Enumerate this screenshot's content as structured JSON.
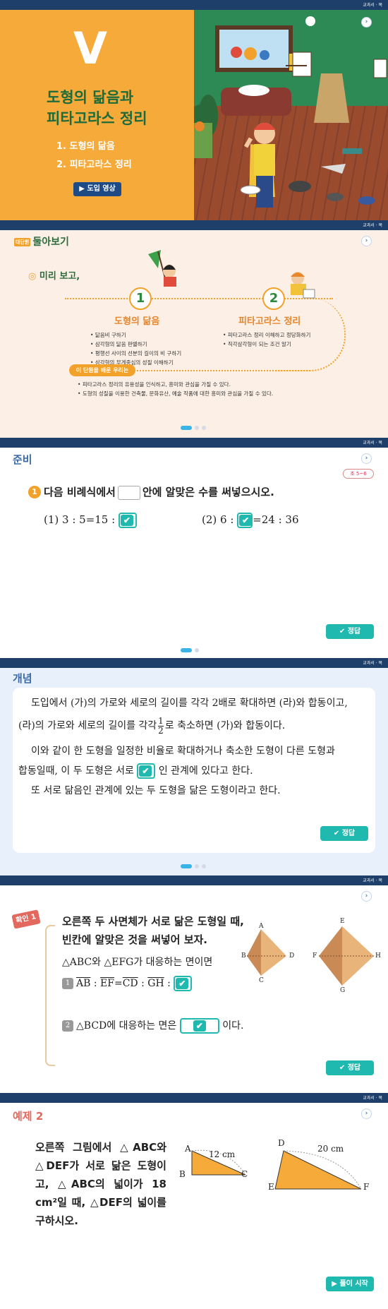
{
  "topbar": {
    "menu": "교과서 · 목"
  },
  "slide1": {
    "roman": "V",
    "title_line1": "도형의 닮음과",
    "title_line2": "피타고라스 정리",
    "items": [
      "1. 도형의 닮음",
      "2. 피타고라스 정리"
    ],
    "intro_button": "▶ 도입 영상"
  },
  "slide2": {
    "header_badge": "대단원",
    "header": "둘아보기",
    "preview": "미리 보고,",
    "sections": [
      {
        "num": "1",
        "title": "도형의 닮음",
        "items": [
          "닮음비 구하기",
          "삼각형의 닮음 판별하기",
          "평행선 사이의 선분의 길이의 비 구하기",
          "삼각형의 무게중심의 성질 이해하기"
        ]
      },
      {
        "num": "2",
        "title": "피타고라스 정리",
        "items": [
          "피타고라스 정리 이해하고 정당화하기",
          "직각삼각형이 되는 조건 알기"
        ]
      }
    ],
    "learned_tag": "이 단원을 배운 우리는",
    "learned_items": [
      "피타고라스 정리의 유용성을 인식하고, 흥미와 관심을 가질 수 있다.",
      "도형의 성질을 이용한 건축물, 문화유산, 예술 작품에 대한 흥미와 관심을 가질 수 있다."
    ]
  },
  "slide3": {
    "header": "준비",
    "page_ref": "초 5~6",
    "q_num": "1",
    "q_before": "다음 비례식에서",
    "q_after": "안에 알맞은 수를 써넣으시오.",
    "p1_label": "(1) 3 : 5=15 :",
    "p2_label": "(2) 6 :",
    "p2_after": "=24 : 36",
    "answer_button": "✔ 정답"
  },
  "slide4": {
    "header": "개념",
    "para1_a": "도입에서 (가)의 가로와 세로의 길이를 각각 2배로 확대하면 (라)와 합동이고,",
    "para1_b": "(라)의 가로와 세로의 길이를 각각",
    "frac_n": "1",
    "frac_d": "2",
    "para1_c": "로 축소하면 (가)와 합동이다.",
    "para2_a": "이와 같이 한 도형을 일정한 비율로 확대하거나 축소한 도형이 다른 도형과",
    "para2_b": "합동일때, 이 두 도형은 서로",
    "para2_c": "인 관계에 있다고 한다.",
    "para3": "또 서로 닮음인 관계에 있는 두 도형을 닮은 도형이라고 한다.",
    "answer_button": "✔ 정답"
  },
  "slide5": {
    "tag": "확인 1",
    "question": "오른쪽 두 사면체가 서로 닮은 도형일 때, 빈칸에 알맞은 것을 써넣어 보자.",
    "line1": "△ABC와 △EFG가 대응하는 면이면",
    "num1": "1",
    "line2_ab": "AB",
    "line2_ef": "EF",
    "line2_cd": "CD",
    "line2_gh": "GH",
    "num2": "2",
    "line3_a": "△BCD에 대응하는 면은",
    "line3_b": "이다.",
    "labels1": [
      "A",
      "B",
      "C",
      "D"
    ],
    "labels2": [
      "E",
      "F",
      "G",
      "H"
    ],
    "answer_button": "✔ 정답"
  },
  "slide6": {
    "header": "예제 2",
    "question": "오른쪽 그림에서 △ABC와 △DEF가 서로 닮은 도형이고, △ABC의 넓이가 18 cm²일 때, △DEF의 넓이를 구하시오.",
    "t1": {
      "a": "A",
      "b": "B",
      "c": "C",
      "len": "12 cm"
    },
    "t2": {
      "d": "D",
      "e": "E",
      "f": "F",
      "len": "20 cm"
    },
    "start_button": "▶ 풀이 시작"
  },
  "colors": {
    "accent": "#1fb9b0",
    "topbar": "#1f3f6b",
    "orange": "#f5aa3a",
    "green": "#2e8a55"
  }
}
